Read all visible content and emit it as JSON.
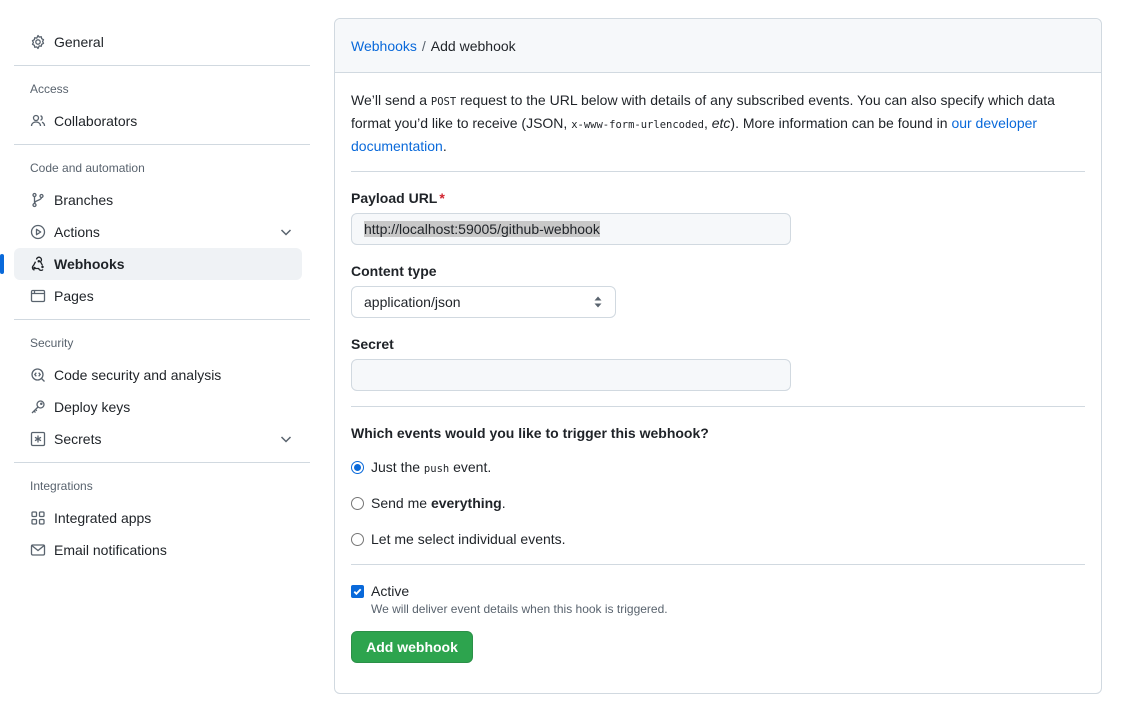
{
  "sidebar": {
    "general": {
      "label": "General",
      "icon": "gear-icon"
    },
    "groups": [
      {
        "heading": "Access",
        "items": [
          {
            "label": "Collaborators",
            "icon": "people-icon"
          }
        ]
      },
      {
        "heading": "Code and automation",
        "items": [
          {
            "label": "Branches",
            "icon": "git-branch-icon"
          },
          {
            "label": "Actions",
            "icon": "play-icon",
            "expandable": true
          },
          {
            "label": "Webhooks",
            "icon": "webhook-icon",
            "active": true
          },
          {
            "label": "Pages",
            "icon": "browser-icon"
          }
        ]
      },
      {
        "heading": "Security",
        "items": [
          {
            "label": "Code security and analysis",
            "icon": "codescan-icon"
          },
          {
            "label": "Deploy keys",
            "icon": "key-icon"
          },
          {
            "label": "Secrets",
            "icon": "asterisk-icon",
            "expandable": true
          }
        ]
      },
      {
        "heading": "Integrations",
        "items": [
          {
            "label": "Integrated apps",
            "icon": "apps-icon"
          },
          {
            "label": "Email notifications",
            "icon": "mail-icon"
          }
        ]
      }
    ]
  },
  "breadcrumb": {
    "parent": "Webhooks",
    "separator": "/",
    "current": "Add webhook"
  },
  "intro": {
    "part1": "We’ll send a ",
    "code1": "POST",
    "part2": " request to the URL below with details of any subscribed events. You can also specify which data format you’d like to receive (JSON, ",
    "code2": "x-www-form-urlencoded",
    "part3": ", ",
    "em": "etc",
    "part4": "). More information can be found in ",
    "link": "our developer documentation",
    "part5": "."
  },
  "payload_url": {
    "label": "Payload URL",
    "required_mark": "*",
    "value": "http://localhost:59005/github-webhook"
  },
  "content_type": {
    "label": "Content type",
    "value": "application/json"
  },
  "secret": {
    "label": "Secret",
    "value": ""
  },
  "events": {
    "question": "Which events would you like to trigger this webhook?",
    "opt1_pre": "Just the ",
    "opt1_code": "push",
    "opt1_post": " event.",
    "opt2_pre": "Send me ",
    "opt2_bold": "everything",
    "opt2_post": ".",
    "opt3": "Let me select individual events.",
    "selected": 1
  },
  "active": {
    "label": "Active",
    "checked": true,
    "note": "We will deliver event details when this hook is triggered."
  },
  "submit": {
    "label": "Add webhook"
  },
  "colors": {
    "link": "#0969da",
    "primary_button": "#2da44e",
    "required": "#d1242f"
  }
}
